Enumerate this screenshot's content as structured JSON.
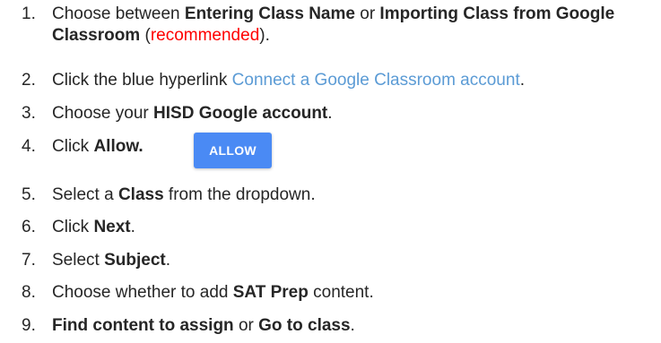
{
  "steps": [
    {
      "num": "1.",
      "parts": {
        "a": "Choose between ",
        "b": "Entering Class Name",
        "c": " or ",
        "d": "Importing Class from Google Classroom",
        "e": " (",
        "f": "recommended",
        "g": ")."
      }
    },
    {
      "num": "2.",
      "parts": {
        "a": "Click the blue hyperlink ",
        "b": "Connect a Google Classroom account",
        "c": "."
      }
    },
    {
      "num": "3.",
      "parts": {
        "a": "Choose your ",
        "b": "HISD Google account",
        "c": "."
      }
    },
    {
      "num": "4.",
      "parts": {
        "a": "Click ",
        "b": "Allow."
      }
    },
    {
      "num": "5.",
      "parts": {
        "a": "Select a ",
        "b": "Class",
        "c": " from the dropdown."
      }
    },
    {
      "num": "6.",
      "parts": {
        "a": "Click ",
        "b": "Next",
        "c": "."
      }
    },
    {
      "num": "7.",
      "parts": {
        "a": "Select ",
        "b": "Subject",
        "c": "."
      }
    },
    {
      "num": "8.",
      "parts": {
        "a": "Choose whether to add ",
        "b": "SAT Prep",
        "c": " content."
      }
    },
    {
      "num": "9.",
      "parts": {
        "a": "Find content to assign",
        "b": " or ",
        "c": "Go to class",
        "d": "."
      }
    }
  ],
  "allow_button": {
    "label": "ALLOW"
  },
  "colors": {
    "text": "#262626",
    "recommended": "#ff0000",
    "hyperlink": "#5b9bd5",
    "allow_button": "#4a8af4"
  }
}
